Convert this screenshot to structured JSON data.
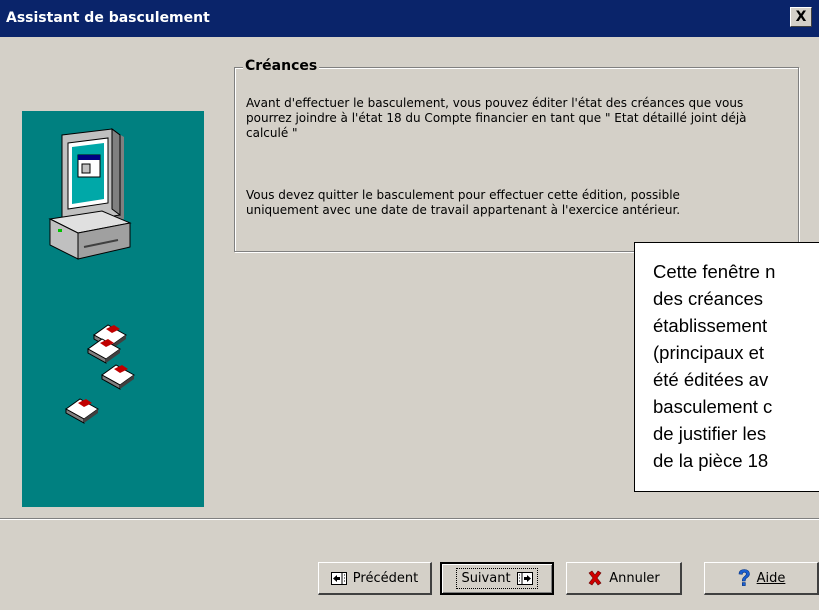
{
  "window": {
    "title": "Assistant de basculement",
    "close_glyph": "X"
  },
  "group": {
    "title": "Créances",
    "paragraph1": "Avant d'effectuer le basculement, vous pouvez éditer l'état des créances que vous pourrez joindre à l'état 18 du Compte financier en tant que \" Etat détaillé joint déjà calculé \"",
    "paragraph2": "Vous devez quitter le basculement pour effectuer cette édition, possible uniquement avec une date de travail appartenant à l'exercice antérieur."
  },
  "callout": {
    "text": "Cette fenêtre n\ndes créances\nétablissement\n(principaux et\nété éditées av\nbasculement c\nde justifier les\nde la pièce 18"
  },
  "buttons": {
    "previous": "Précédent",
    "next": "Suivant",
    "cancel": "Annuler",
    "help": "Aide"
  },
  "icons": {
    "computer": "computer-icon",
    "diskettes": "diskettes-icon",
    "previous": "previous-arrow-icon",
    "next": "next-arrow-icon",
    "cancel": "red-x-icon",
    "help": "question-mark-icon"
  },
  "colors": {
    "titlebar": "#0a246a",
    "side_panel": "#008080",
    "dialog_bg": "#d4d0c8"
  }
}
